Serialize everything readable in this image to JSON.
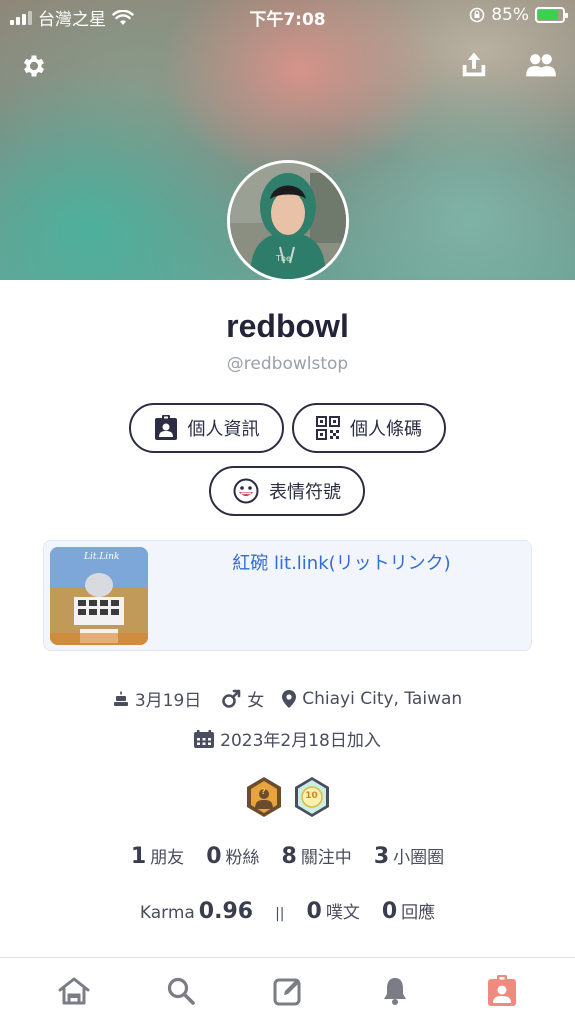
{
  "status_bar": {
    "carrier": "台灣之星",
    "time": "下午7:08",
    "battery_percent": "85%",
    "battery_level": 0.85
  },
  "header": {
    "settings_icon": "gear-icon",
    "share_icon": "share-upload-icon",
    "friends_icon": "friends-icon"
  },
  "profile": {
    "display_name": "redbowl",
    "username": "@redbowlstop"
  },
  "buttons": {
    "profile_info": "個人資訊",
    "profile_barcode": "個人條碼",
    "emoji": "表情符號"
  },
  "link_card": {
    "title": "紅碗 lit.link(リットリンク)",
    "thumb_text": "Lit.Link"
  },
  "meta": {
    "birthday": "3月19日",
    "gender": "女",
    "location": "Chiayi City, Taiwan",
    "joined": "2023年2月18日加入"
  },
  "badges": [
    {
      "name": "secret-badge",
      "text": "?"
    },
    {
      "name": "level-10-badge",
      "text": "10"
    }
  ],
  "stats": {
    "friends_count": "1",
    "friends_label": "朋友",
    "fans_count": "0",
    "fans_label": "粉絲",
    "following_count": "8",
    "following_label": "關注中",
    "cliques_count": "3",
    "cliques_label": "小圈圈"
  },
  "stats2": {
    "karma_label": "Karma",
    "karma_value": "0.96",
    "separator": "||",
    "plurks_count": "0",
    "plurks_label": "噗文",
    "replies_count": "0",
    "replies_label": "回應"
  },
  "tabbar": {
    "items": [
      "home-icon",
      "search-icon",
      "compose-icon",
      "bell-icon",
      "profile-icon"
    ],
    "active": "profile-icon",
    "active_color": "#f08a7e",
    "inactive_color": "#7a7c86"
  }
}
